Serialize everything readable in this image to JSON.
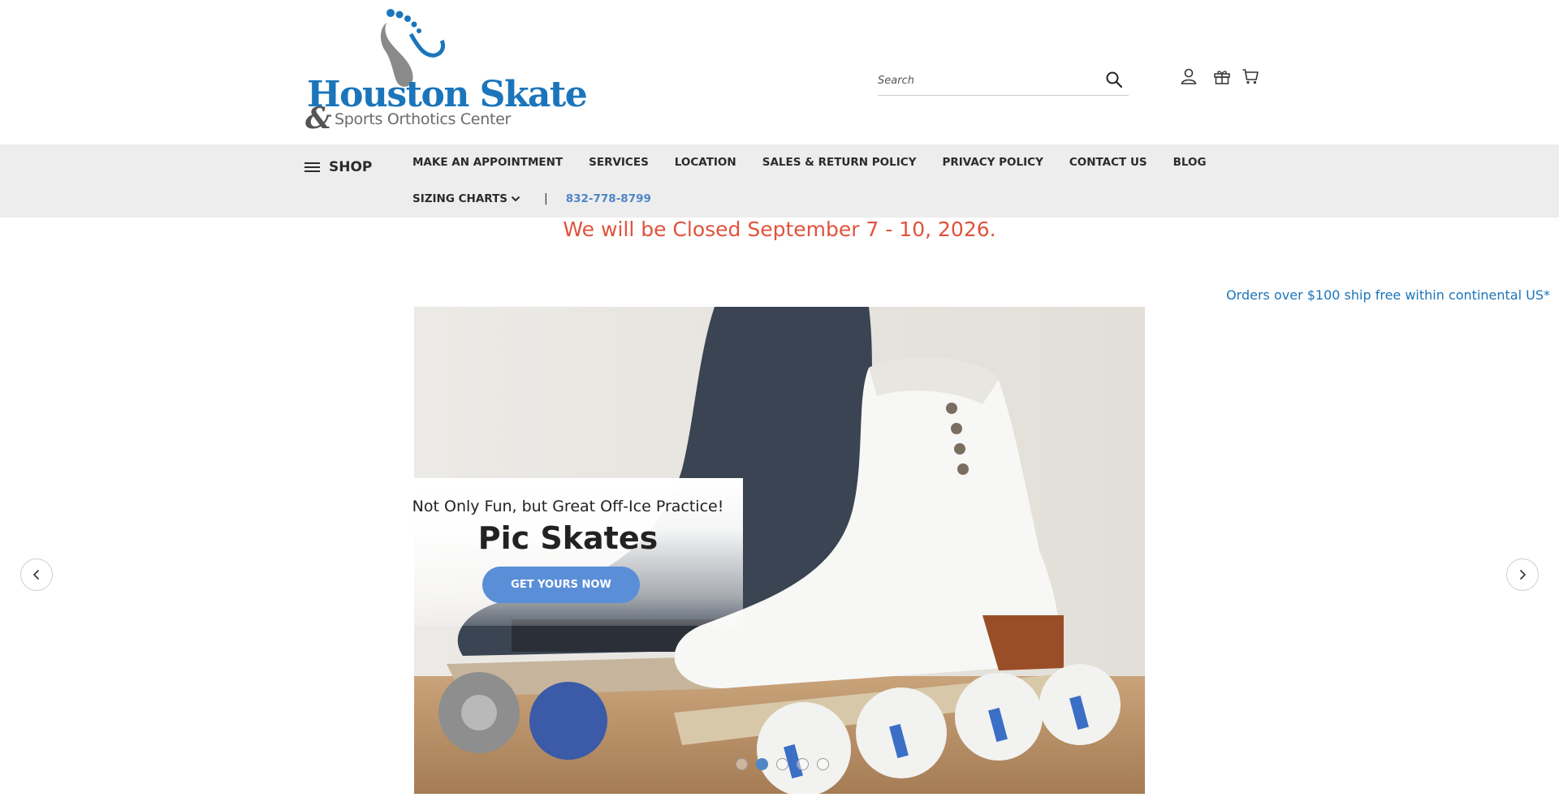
{
  "header": {
    "logo_line1": "Houston Skate",
    "logo_amp": "&",
    "logo_line2": "Sports Orthotics Center",
    "search_placeholder": "Search",
    "icons": [
      "account-icon",
      "gift-icon",
      "cart-icon"
    ]
  },
  "nav": {
    "shop_label": "SHOP",
    "row1": [
      "MAKE AN APPOINTMENT",
      "SERVICES",
      "LOCATION",
      "SALES & RETURN POLICY",
      "PRIVACY POLICY",
      "CONTACT US",
      "BLOG"
    ],
    "sizing_label": "SIZING CHARTS",
    "separator": "|",
    "phone": "832-778-8799"
  },
  "notices": {
    "closed": "We will be Closed September 7 - 10, 2026.",
    "shipping": "Orders over $100 ship free within continental US*"
  },
  "carousel": {
    "subtitle": "Not Only Fun, but Great Off-Ice Practice!",
    "title": "Pic Skates",
    "button_label": "GET YOURS NOW",
    "slide_count": 5,
    "active_slide": 2
  },
  "colors": {
    "brand_blue": "#1b75bb",
    "nav_bg": "#ededed",
    "notice_red": "#e0533c",
    "button_blue": "#5a8fd8",
    "phone_blue": "#4f86c6"
  }
}
